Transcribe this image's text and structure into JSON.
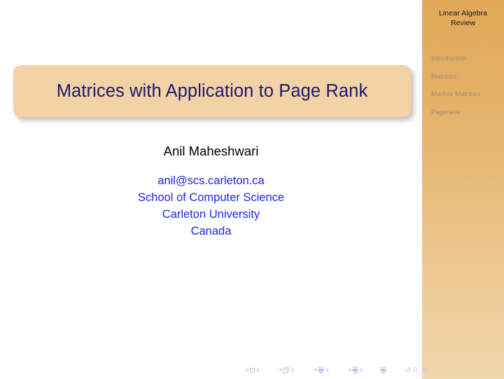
{
  "slide": {
    "kind": "presentation-title-slide",
    "background_color": "#ffffff"
  },
  "sidebar": {
    "header": {
      "line1": "Linear Algebra",
      "line2": "Review"
    },
    "gradient_top_color": "#e0a957",
    "gradient_bottom_color": "#f0d6ab",
    "item_color": "#9c8c74",
    "items": [
      {
        "label": "Introduction"
      },
      {
        "label": "Matrices"
      },
      {
        "label": "Markov Matrices"
      },
      {
        "label": "Pagerank"
      }
    ]
  },
  "title_banner": {
    "title": "Matrices with Application to Page Rank",
    "background_color": "#f3d2a6",
    "text_color": "#191970"
  },
  "author": {
    "name": "Anil Maheshwari",
    "name_color": "#000000",
    "contact_color": "#2222f2",
    "contact_lines": [
      "anil@scs.carleton.ca",
      "School of Computer Science",
      "Carleton University",
      "Canada"
    ]
  },
  "navbar": {
    "color": "#c5c5ea",
    "groups": [
      {
        "icon": "prev-frame-arrow",
        "center": "square-frame-icon",
        "next": "next-frame-arrow"
      },
      {
        "icon": "prev-slide-arrow",
        "center": "cube-slide-icon",
        "next": "next-slide-arrow"
      },
      {
        "icon": "prev-subsection-arrow",
        "center": "stack-subsection-icon",
        "next": "next-subsection-arrow"
      },
      {
        "icon": "prev-section-arrow",
        "center": "stack-section-icon",
        "next": "next-section-arrow"
      }
    ],
    "extras": [
      {
        "name": "back-arrow-icon",
        "glyph": "↺"
      },
      {
        "name": "search-icon",
        "glyph": ""
      },
      {
        "name": "forward-arrow-icon",
        "glyph": "↻"
      }
    ],
    "doc_icon_name": "document-stack-icon"
  }
}
